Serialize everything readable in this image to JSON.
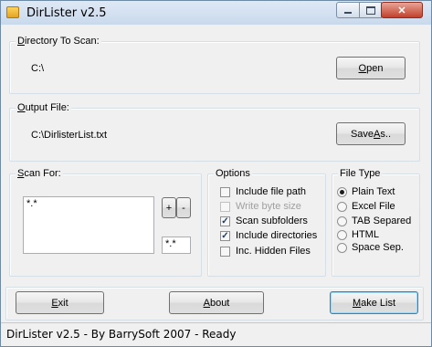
{
  "window": {
    "title": "DirLister v2.5"
  },
  "directory": {
    "label": "Directory To Scan:",
    "label_access": "D",
    "label_rest": "irectory To Scan:",
    "value": "C:\\",
    "open_button": "Open",
    "open_access": "O",
    "open_rest": "pen"
  },
  "output": {
    "label": "Output File:",
    "label_access": "O",
    "label_rest": "utput File:",
    "value": "C:\\DirlisterList.txt",
    "save_button": "Save As..",
    "save_access": "A",
    "save_pre": "Save ",
    "save_rest": "s.."
  },
  "scan": {
    "label": "Scan For:",
    "label_access": "S",
    "label_rest": "can For:",
    "list_items": [
      "*.*"
    ],
    "add_button": "+",
    "remove_button": "-",
    "pattern_input": "*.*"
  },
  "options": {
    "label": "Options",
    "items": [
      {
        "label": "Include file path",
        "checked": false,
        "enabled": true
      },
      {
        "label": "Write byte size",
        "checked": false,
        "enabled": false
      },
      {
        "label": "Scan subfolders",
        "checked": true,
        "enabled": true
      },
      {
        "label": "Include directories",
        "checked": true,
        "enabled": true
      },
      {
        "label": "Inc. Hidden Files",
        "checked": false,
        "enabled": true
      }
    ]
  },
  "filetype": {
    "label": "File Type",
    "items": [
      {
        "label": "Plain Text",
        "selected": true
      },
      {
        "label": "Excel File",
        "selected": false
      },
      {
        "label": "TAB Separed",
        "selected": false
      },
      {
        "label": "HTML",
        "selected": false
      },
      {
        "label": "Space Sep.",
        "selected": false
      }
    ]
  },
  "actions": {
    "exit": "Exit",
    "exit_access": "E",
    "exit_rest": "xit",
    "about": "About",
    "about_access": "A",
    "about_rest": "bout",
    "make": "Make List",
    "make_access": "M",
    "make_rest": "ake List"
  },
  "status": {
    "text": "DirLister v2.5 - By BarrySoft 2007 - Ready"
  }
}
